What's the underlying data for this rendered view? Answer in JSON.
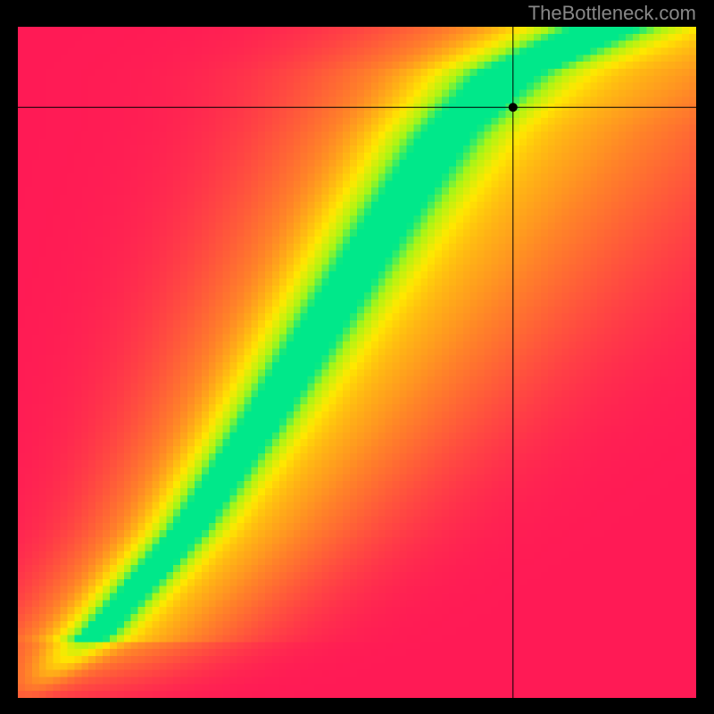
{
  "watermark": "TheBottleneck.com",
  "chart_data": {
    "type": "heatmap",
    "title": "",
    "xlabel": "",
    "ylabel": "",
    "x_range": [
      0,
      100
    ],
    "y_range": [
      0,
      100
    ],
    "grid_cells": 96,
    "color_scale": {
      "low": "#FF1A55",
      "mid_low": "#FF8328",
      "mid": "#FFE800",
      "mid_high": "#A8F516",
      "high": "#00E88A"
    },
    "ridge": {
      "description": "Green optimal band following a monotone increasing S-curve from bottom-left to upper-right",
      "control_points_xy_pct": [
        [
          2,
          1
        ],
        [
          12,
          10
        ],
        [
          25,
          25
        ],
        [
          35,
          40
        ],
        [
          45,
          56
        ],
        [
          55,
          72
        ],
        [
          63,
          84
        ],
        [
          72,
          93
        ],
        [
          85,
          99
        ]
      ],
      "band_halfwidth_x_pct_at_y": [
        [
          0,
          2.5
        ],
        [
          30,
          3.5
        ],
        [
          55,
          4.5
        ],
        [
          85,
          5.5
        ],
        [
          100,
          7
        ]
      ]
    },
    "marker": {
      "x_pct": 73,
      "y_pct": 88,
      "crosshair": true,
      "dot_radius_px": 5
    }
  }
}
